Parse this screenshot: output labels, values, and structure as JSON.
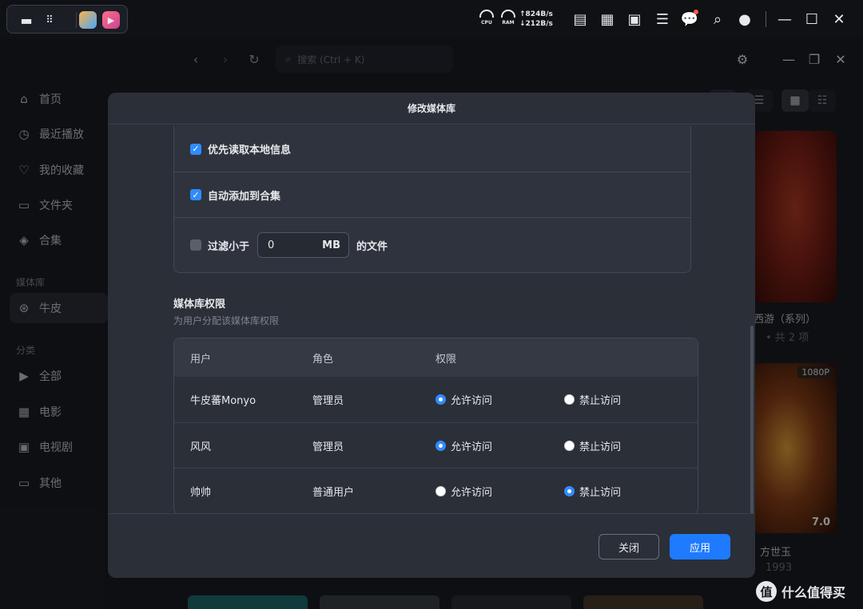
{
  "os_bar": {
    "cpu_label": "CPU",
    "ram_label": "RAM",
    "upload_speed": "↑824B/s",
    "download_speed": "↓212B/s"
  },
  "app": {
    "search_placeholder": "搜索 (Ctrl + K)",
    "sidebar": {
      "items": [
        {
          "label": "首页",
          "icon": "home-icon"
        },
        {
          "label": "最近播放",
          "icon": "clock-icon"
        },
        {
          "label": "我的收藏",
          "icon": "heart-icon"
        },
        {
          "label": "文件夹",
          "icon": "folder-icon"
        },
        {
          "label": "合集",
          "icon": "layers-icon"
        }
      ],
      "media_section": "媒体库",
      "library": {
        "label": "牛皮",
        "icon": "library-icon"
      },
      "category_section": "分类",
      "categories": [
        {
          "label": "全部",
          "icon": "play-square-icon"
        },
        {
          "label": "电影",
          "icon": "film-icon"
        },
        {
          "label": "电视剧",
          "icon": "tv-icon"
        },
        {
          "label": "其他",
          "icon": "video-icon"
        }
      ]
    },
    "posters": [
      {
        "title": "西游（系列）",
        "sub": "• 共 2 项"
      },
      {
        "title": "方世玉",
        "sub": "1993",
        "quality": "1080P",
        "rating": "7.0"
      }
    ],
    "watermark": "什么值得买"
  },
  "modal": {
    "title": "修改媒体库",
    "options": [
      {
        "label": "优先读取本地信息",
        "checked": true
      },
      {
        "label": "自动添加到合集",
        "checked": true
      }
    ],
    "filter": {
      "prefix": "过滤小于",
      "value": "0",
      "unit": "MB",
      "suffix": "的文件",
      "checked": false
    },
    "permissions": {
      "title": "媒体库权限",
      "description": "为用户分配该媒体库权限",
      "headers": {
        "user": "用户",
        "role": "角色",
        "permission": "权限"
      },
      "allow_label": "允许访问",
      "deny_label": "禁止访问",
      "rows": [
        {
          "user": "牛皮蕃Monyo",
          "role": "管理员",
          "access": "allow"
        },
        {
          "user": "风风",
          "role": "管理员",
          "access": "allow"
        },
        {
          "user": "帅帅",
          "role": "普通用户",
          "access": "deny"
        }
      ]
    },
    "buttons": {
      "close": "关闭",
      "apply": "应用"
    },
    "accent_color": "#2f8cff"
  }
}
